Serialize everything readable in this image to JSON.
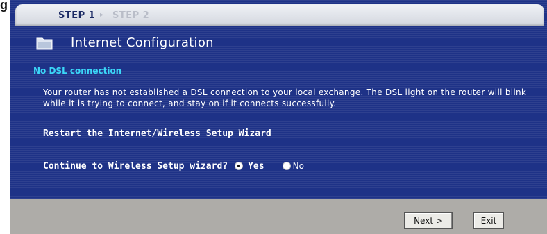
{
  "steps": {
    "active": "STEP 1",
    "inactive": "STEP 2"
  },
  "page": {
    "title": "Internet Configuration",
    "section_title": "No DSL connection",
    "message": "Your router has not established a DSL connection to your local exchange. The DSL light on the router will blink while it is trying to connect, and stay on if it connects successfully.",
    "restart_link": "Restart the Internet/Wireless Setup Wizard"
  },
  "wireless_prompt": {
    "question": "Continue to Wireless Setup wizard?",
    "options": [
      {
        "label": "Yes",
        "selected": true
      },
      {
        "label": "No",
        "selected": false
      }
    ]
  },
  "buttons": {
    "next": "Next >",
    "exit": "Exit"
  },
  "colors": {
    "background": "#1e3287",
    "section_title": "#3bd8f8",
    "footer": "#aeaca8"
  },
  "icons": {
    "folder": "folder-icon",
    "step_separator": "arrow-right-icon"
  }
}
